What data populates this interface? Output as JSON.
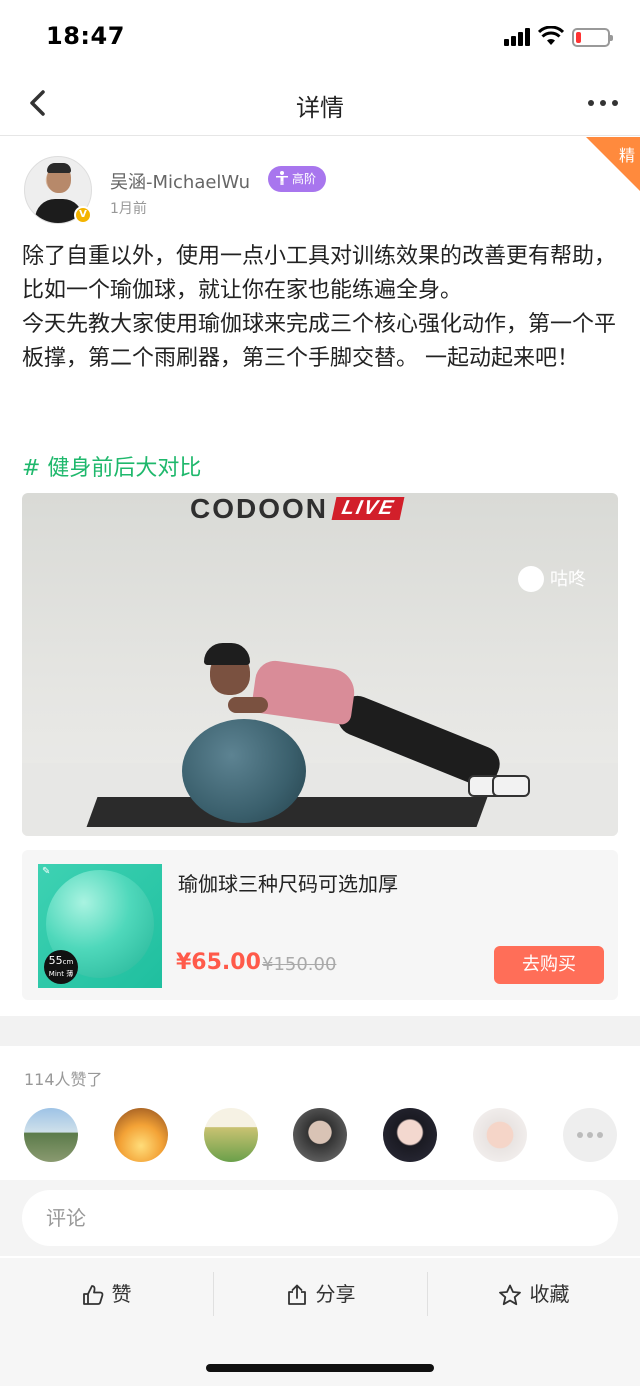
{
  "status_bar": {
    "time": "18:47",
    "battery_level": 0.18,
    "battery_color": "#ff3333"
  },
  "nav": {
    "title": "详情",
    "back_icon": "chevron-left-icon",
    "more_icon": "more-horizontal-icon"
  },
  "corner_badge": {
    "label": "精",
    "color": "#ff8a3d"
  },
  "author": {
    "name": "吴涵-MichaelWu",
    "level": "高阶",
    "verified_label": "V",
    "time": "1月前"
  },
  "post": {
    "paragraph_1": "除了自重以外，使用一点小工具对训练效果的改善更有帮助，比如一个瑜伽球，就让你在家也能练遍全身。",
    "paragraph_2": "今天先教大家使用瑜伽球来完成三个核心强化动作，第一个平板撑，第二个雨刷器，第三个手脚交替。 一起动起来吧！",
    "hashtag": "# 健身前后大对比"
  },
  "video": {
    "brand": "CODOON",
    "brand_tag": "LIVE",
    "watermark": "咕咚"
  },
  "product": {
    "title": "瑜伽球三种尺码可选加厚",
    "price": "¥65.00",
    "original_price": "¥150.00",
    "buy_label": "去购买",
    "image_size": "55",
    "image_size_unit": "cm",
    "image_sub": "Mint 薄"
  },
  "likes": {
    "count_label": "114人赞了"
  },
  "comment": {
    "placeholder": "评论"
  },
  "actions": {
    "like": "赞",
    "share": "分享",
    "favorite": "收藏"
  },
  "colors": {
    "accent_green": "#1fb86c",
    "price_red": "#ff5a4a",
    "buy_button": "#ff6e58",
    "level_badge": "#a876ee"
  }
}
